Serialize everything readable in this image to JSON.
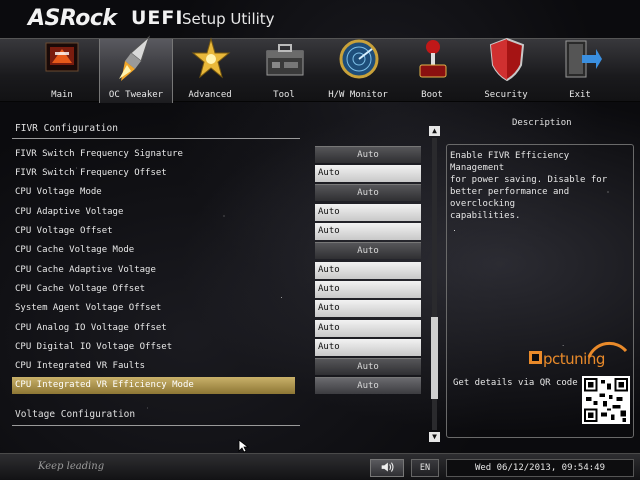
{
  "header": {
    "brand": "ASRock",
    "product": "UEFI",
    "product_sub": "Setup Utility"
  },
  "nav": [
    {
      "label": "Main",
      "icon": "main-board-icon"
    },
    {
      "label": "OC Tweaker",
      "icon": "rocket-icon",
      "active": true
    },
    {
      "label": "Advanced",
      "icon": "star-burst-icon"
    },
    {
      "label": "Tool",
      "icon": "toolbox-icon"
    },
    {
      "label": "H/W Monitor",
      "icon": "radar-icon"
    },
    {
      "label": "Boot",
      "icon": "joystick-icon"
    },
    {
      "label": "Security",
      "icon": "shield-icon"
    },
    {
      "label": "Exit",
      "icon": "exit-door-icon"
    }
  ],
  "sections": {
    "fivr_title": "FIVR Configuration",
    "voltage_title": "Voltage Configuration"
  },
  "settings": [
    {
      "label": "FIVR Switch Frequency Signature",
      "value": "Auto",
      "kind": "btn"
    },
    {
      "label": "FIVR Switch Frequency Offset",
      "value": "Auto",
      "kind": "input"
    },
    {
      "label": "CPU Voltage Mode",
      "value": "Auto",
      "kind": "btn"
    },
    {
      "label": "CPU Adaptive Voltage",
      "value": "Auto",
      "kind": "input"
    },
    {
      "label": "CPU Voltage Offset",
      "value": "Auto",
      "kind": "input"
    },
    {
      "label": "CPU Cache Voltage Mode",
      "value": "Auto",
      "kind": "btn"
    },
    {
      "label": "CPU Cache Adaptive Voltage",
      "value": "Auto",
      "kind": "input"
    },
    {
      "label": "CPU Cache Voltage Offset",
      "value": "Auto",
      "kind": "input"
    },
    {
      "label": "System Agent Voltage Offset",
      "value": "Auto",
      "kind": "input"
    },
    {
      "label": "CPU Analog IO Voltage Offset",
      "value": "Auto",
      "kind": "input"
    },
    {
      "label": "CPU Digital IO Voltage Offset",
      "value": "Auto",
      "kind": "input"
    },
    {
      "label": "CPU Integrated VR Faults",
      "value": "Auto",
      "kind": "btn"
    },
    {
      "label": "CPU Integrated VR Efficiency Mode",
      "value": "Auto",
      "kind": "btn",
      "selected": true
    }
  ],
  "scroll": {
    "position_fraction": 0.85,
    "visible_fraction": 0.28
  },
  "description": {
    "title": "Description",
    "text": "Enable FIVR Efficiency Management\nfor power saving. Disable for\nbetter performance and overclocking\ncapabilities.",
    "watermark": "pctuning",
    "qr_label": "Get details via QR code"
  },
  "footer": {
    "slogan": "Keep leading",
    "speaker_icon": "speaker-icon",
    "language": "EN",
    "datetime": "Wed 06/12/2013, 09:54:49"
  },
  "colors": {
    "selection": "#b59b4e",
    "accent_orange": "#e98a2a"
  }
}
